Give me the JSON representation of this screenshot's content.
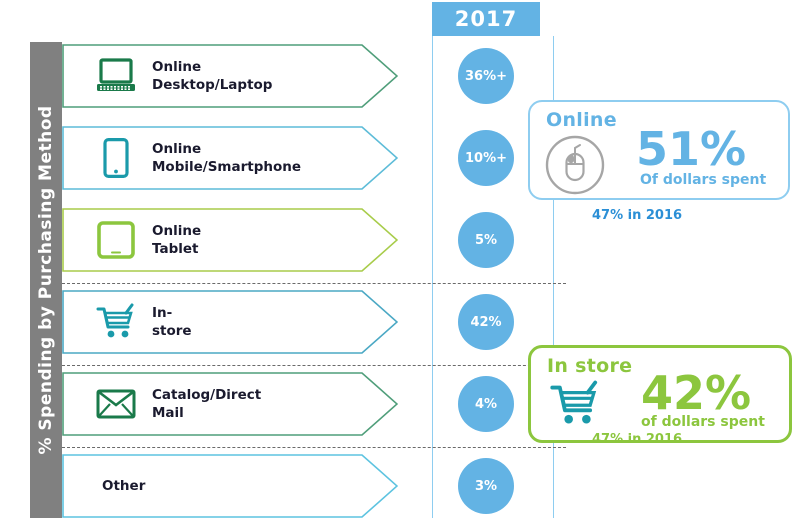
{
  "axis": {
    "label": "% Spending  by Purchasing Method",
    "band_color": "#808080"
  },
  "year_column": {
    "header": "2017",
    "header_bg": "#63b3e4",
    "bubble_color": "#63b3e4"
  },
  "rows": [
    {
      "icon": "laptop-icon",
      "label": "Online\nDesktop/Laptop",
      "value": "36%+",
      "outline_color": "#4f9e7a"
    },
    {
      "icon": "smartphone-icon",
      "label": "Online\nMobile/Smartphone",
      "value": "10%+",
      "outline_color": "#5dbcd8"
    },
    {
      "icon": "tablet-icon",
      "label": "Online\nTablet",
      "value": "5%",
      "outline_color": "#a8cc4a"
    },
    {
      "icon": "shopping-cart-icon",
      "label": "In-store",
      "value": "42%",
      "outline_color": "#4aa8c4"
    },
    {
      "icon": "envelope-icon",
      "label": "Catalog/Direct Mail",
      "value": "4%",
      "outline_color": "#4f9e7a"
    },
    {
      "icon": "none-icon",
      "label": "Other",
      "value": "3%",
      "outline_color": "#5dc3e0"
    }
  ],
  "callouts": [
    {
      "key": "online",
      "title": "Online",
      "icon": "computer-mouse-icon",
      "percent": "51%",
      "subtitle": "Of dollars spent",
      "footnote": "47% in 2016",
      "accent": "#63b3e4"
    },
    {
      "key": "instore",
      "title": "In store",
      "icon": "shopping-cart-icon",
      "percent": "42%",
      "subtitle": "of dollars spent",
      "footnote": "47% in 2016",
      "accent": "#8cc63e"
    }
  ]
}
